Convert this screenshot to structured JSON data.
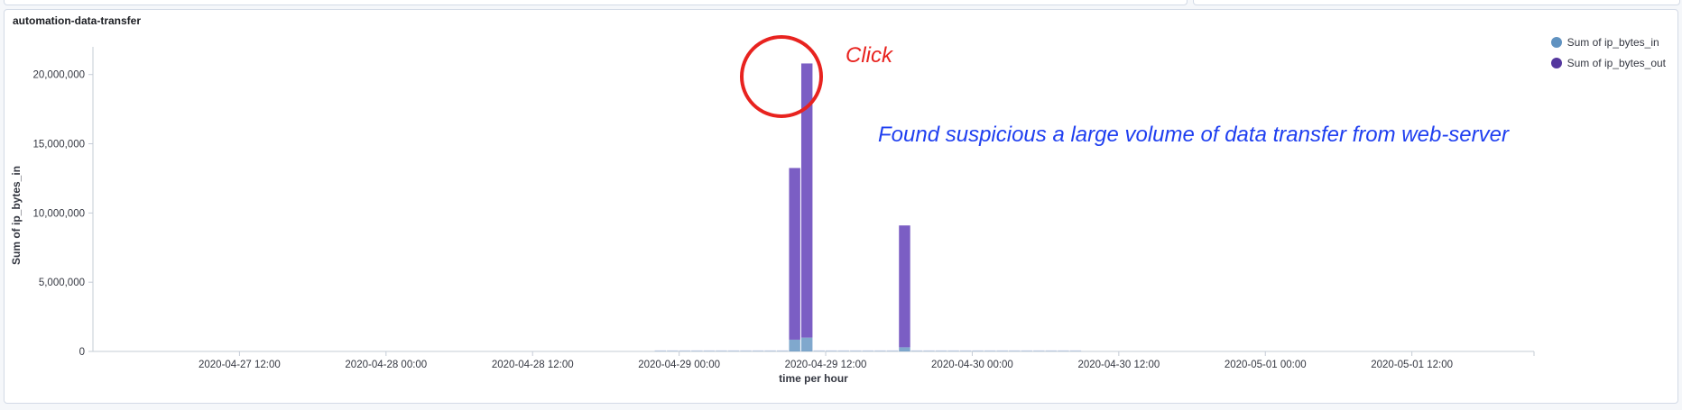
{
  "panel": {
    "title": "automation-data-transfer"
  },
  "annotations": {
    "click_text": "Click",
    "finding_text": "Found suspicious a large volume of data transfer from web-server"
  },
  "chart_data": {
    "type": "bar",
    "stacked": true,
    "xlabel": "time per hour",
    "ylabel": "Sum of ip_bytes_in",
    "ylim": [
      0,
      22000000
    ],
    "yticks": [
      {
        "value": 0,
        "label": "0"
      },
      {
        "value": 5000000,
        "label": "5,000,000"
      },
      {
        "value": 10000000,
        "label": "10,000,000"
      },
      {
        "value": 15000000,
        "label": "15,000,000"
      },
      {
        "value": 20000000,
        "label": "20,000,000"
      }
    ],
    "xrange": [
      "2020-04-27 00:00",
      "2020-05-01 22:00"
    ],
    "xticks": [
      "2020-04-27 12:00",
      "2020-04-28 00:00",
      "2020-04-28 12:00",
      "2020-04-29 00:00",
      "2020-04-29 12:00",
      "2020-04-30 00:00",
      "2020-04-30 12:00",
      "2020-05-01 00:00",
      "2020-05-01 12:00"
    ],
    "legend_position": "top-right",
    "grid": false,
    "series": [
      {
        "name": "Sum of ip_bytes_in",
        "color": "#6092c0"
      },
      {
        "name": "Sum of ip_bytes_out",
        "color": "#54379e"
      }
    ],
    "bars": [
      {
        "x": "2020-04-29 09:00",
        "ip_bytes_in": 850000,
        "ip_bytes_out": 12400000
      },
      {
        "x": "2020-04-29 10:00",
        "ip_bytes_in": 1000000,
        "ip_bytes_out": 19800000
      },
      {
        "x": "2020-04-29 18:00",
        "ip_bytes_in": 300000,
        "ip_bytes_out": 8800000
      }
    ],
    "baseline_hours": {
      "from": "2020-04-28 22:00",
      "to": "2020-04-30 08:00",
      "ip_bytes_in": 60000,
      "ip_bytes_out": 20000
    }
  }
}
